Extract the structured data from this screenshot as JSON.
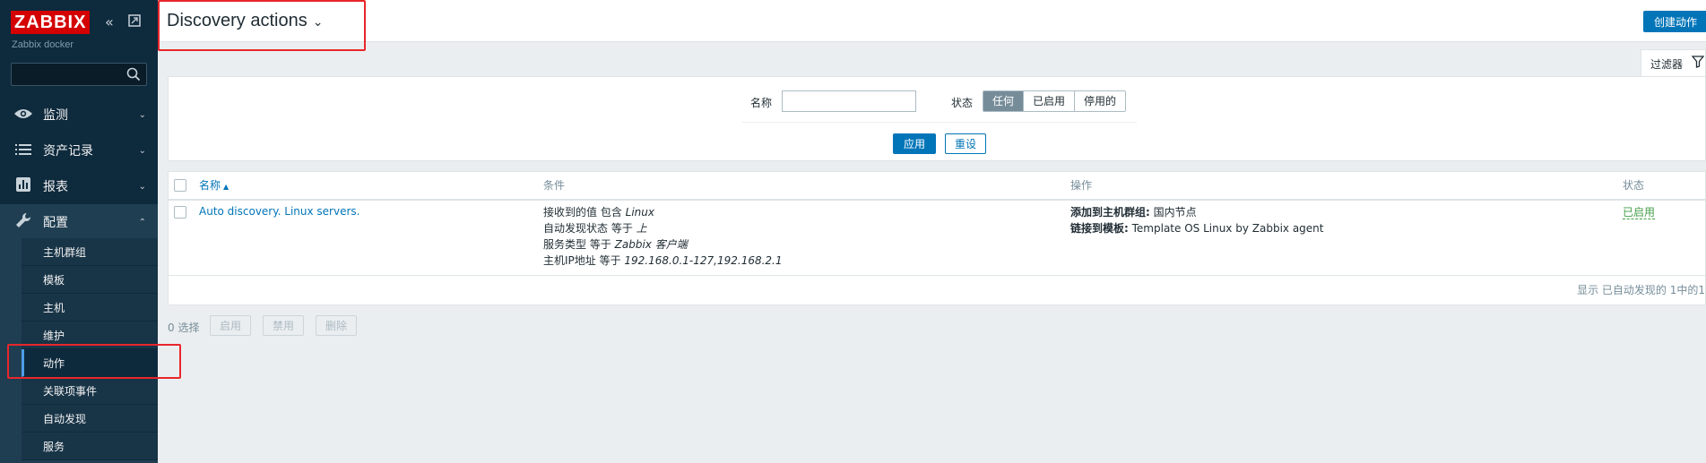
{
  "sidebar": {
    "logo": "ZABBIX",
    "server_name": "Zabbix docker",
    "search_placeholder": "",
    "menu": [
      {
        "label": "监测",
        "icon": "eye-icon"
      },
      {
        "label": "资产记录",
        "icon": "list-icon"
      },
      {
        "label": "报表",
        "icon": "bar-chart-icon"
      },
      {
        "label": "配置",
        "icon": "wrench-icon"
      }
    ],
    "submenu": [
      "主机群组",
      "模板",
      "主机",
      "维护",
      "动作",
      "关联项事件",
      "自动发现",
      "服务"
    ],
    "active_submenu": "动作"
  },
  "header": {
    "title": "Discovery actions",
    "create_button": "创建动作"
  },
  "filter": {
    "tab_label": "过滤器",
    "name_label": "名称",
    "name_value": "",
    "status_label": "状态",
    "status_options": [
      "任何",
      "已启用",
      "停用的"
    ],
    "status_selected": "任何",
    "apply": "应用",
    "reset": "重设"
  },
  "table": {
    "columns": {
      "name": "名称",
      "sort_arrow": "▲",
      "conditions": "条件",
      "operations": "操作",
      "status": "状态"
    },
    "rows": [
      {
        "name": "Auto discovery. Linux servers.",
        "conditions": [
          {
            "prefix": "接收到的值 包含 ",
            "value": "Linux"
          },
          {
            "prefix": "自动发现状态 等于 ",
            "value": "上"
          },
          {
            "prefix": "服务类型 等于 ",
            "value": "Zabbix 客户端"
          },
          {
            "prefix": "主机IP地址 等于 ",
            "value": "192.168.0.1-127,192.168.2.1"
          }
        ],
        "operations": [
          {
            "label": "添加到主机群组:",
            "value": " 国内节点"
          },
          {
            "label": "链接到模板:",
            "value": " Template OS Linux by Zabbix agent"
          }
        ],
        "status": "已启用"
      }
    ],
    "footer": "显示 已自动发现的 1中的1"
  },
  "bulk_actions": {
    "selected": "0 选择",
    "enable": "启用",
    "disable": "禁用",
    "delete": "删除"
  },
  "colors": {
    "sidebar_bg": "#0e2a3d",
    "accent": "#0275b8",
    "logo_red": "#d40000",
    "status_green": "#429e47",
    "highlight_red": "#e8262b"
  }
}
